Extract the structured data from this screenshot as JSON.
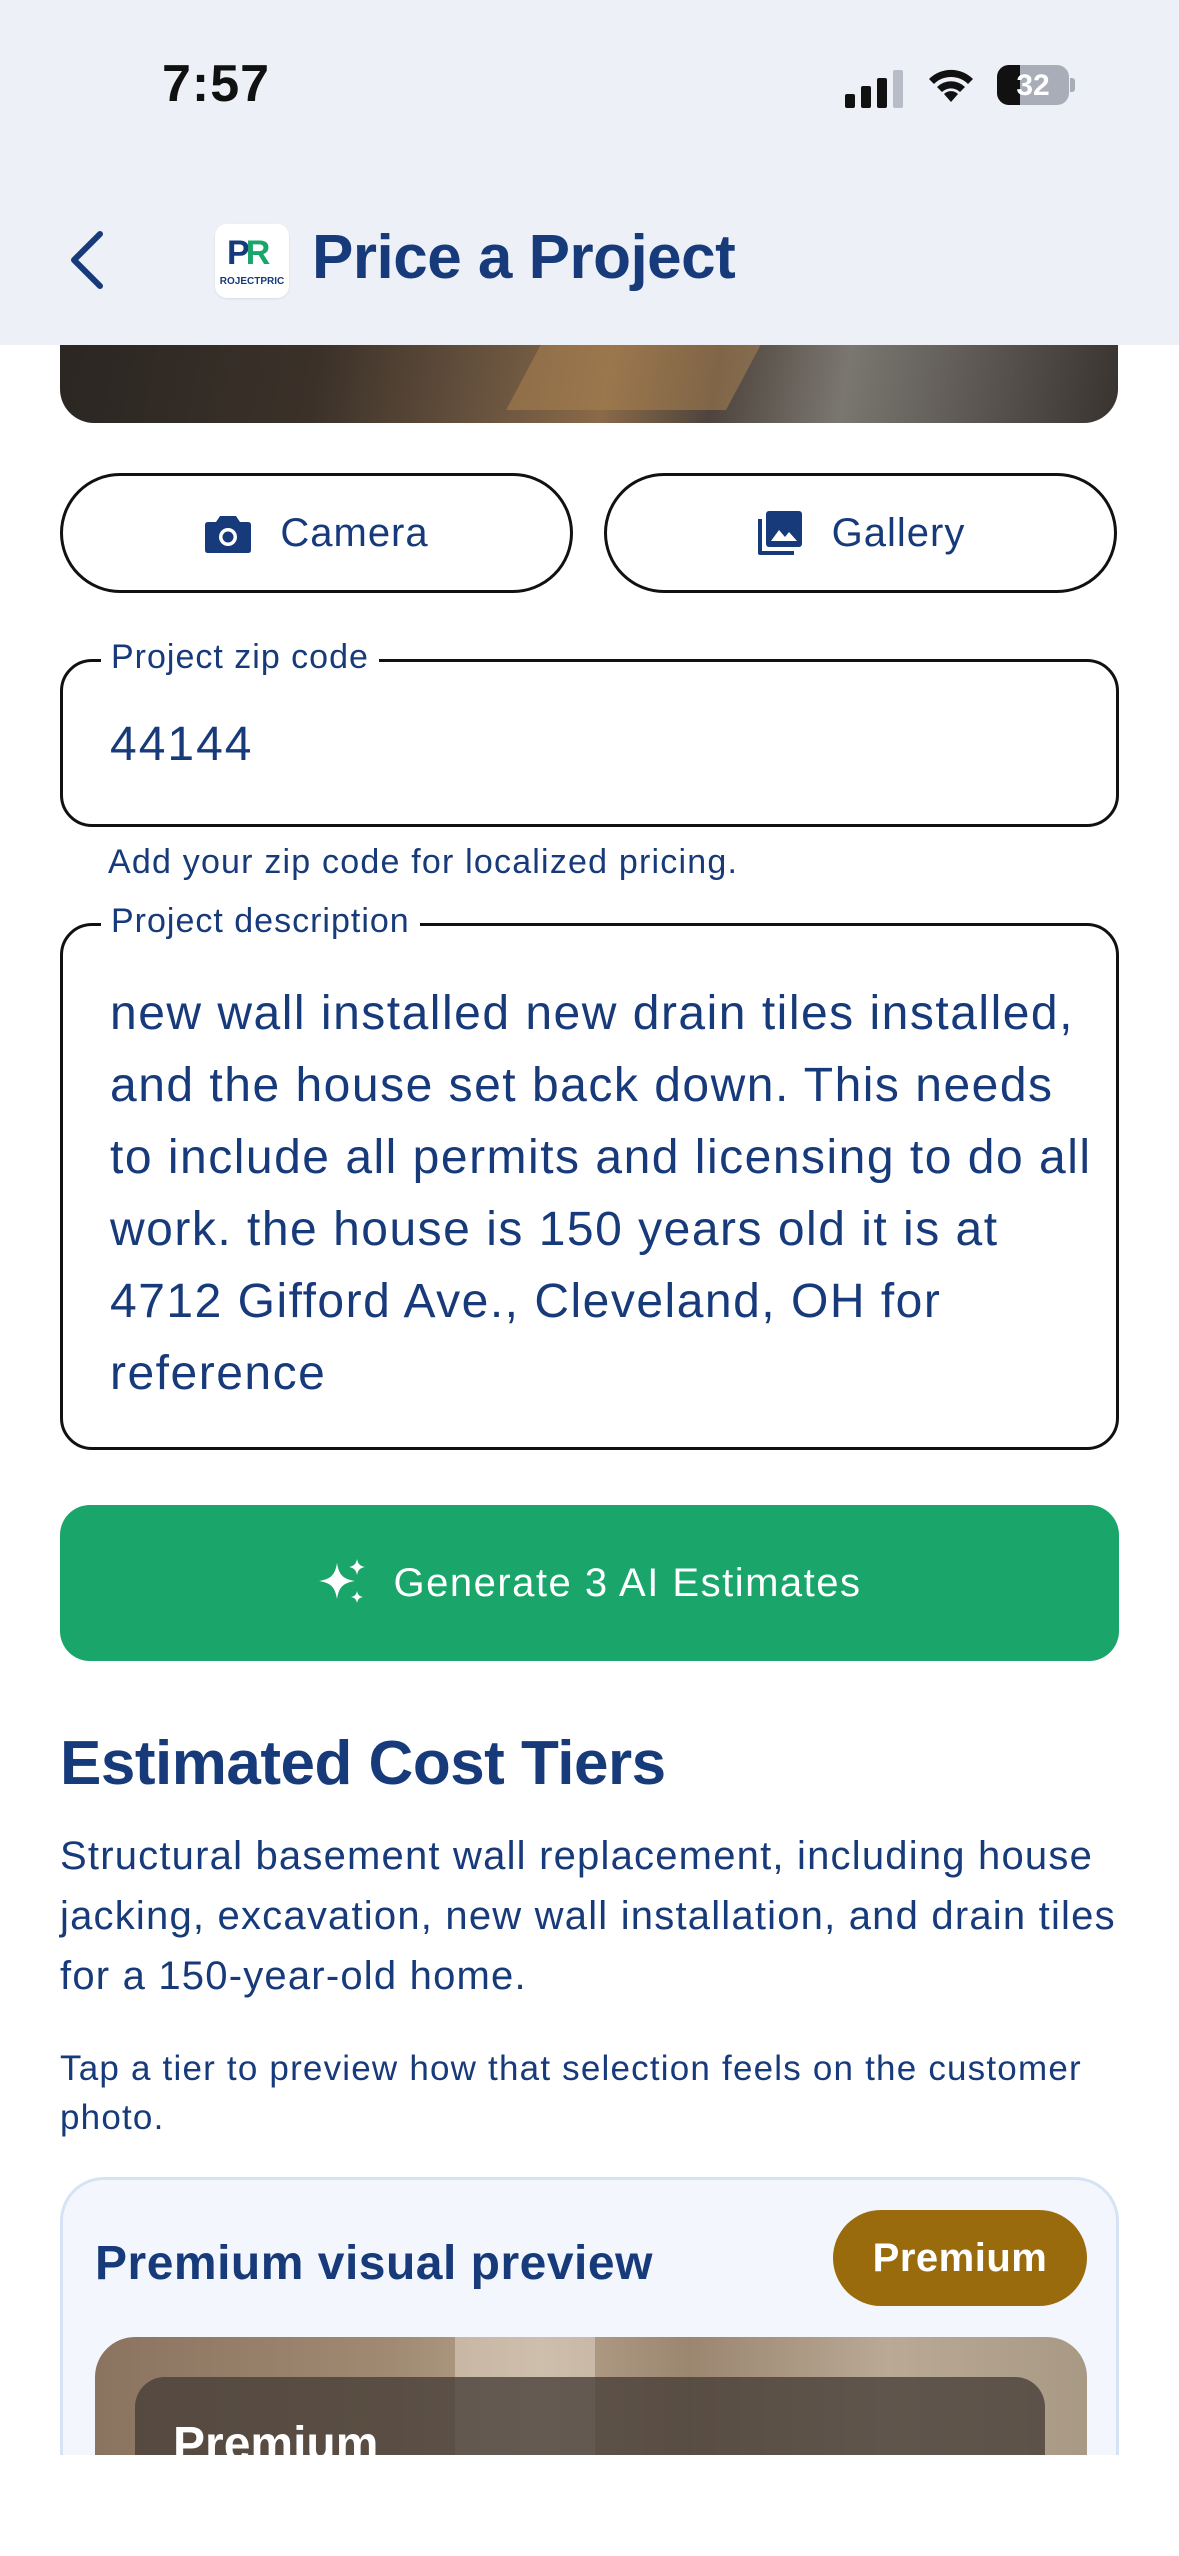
{
  "status_bar": {
    "time": "7:57",
    "battery_percent": "32",
    "battery_level": 0.32
  },
  "header": {
    "title": "Price a Project",
    "logo_text": "PR",
    "logo_caption": "ROJECTPRIC"
  },
  "media_buttons": {
    "camera_label": "Camera",
    "gallery_label": "Gallery"
  },
  "form": {
    "zip_label": "Project zip code",
    "zip_value": "44144",
    "zip_helper": "Add your zip code for localized pricing.",
    "description_label": "Project description",
    "description_value": "new wall installed new drain tiles installed, and the house set back down. This needs to include all permits and licensing to do all work. the house is 150 years old it is at 4712 Gifford Ave., Cleveland, OH for reference"
  },
  "generate_button": {
    "label": "Generate 3 AI Estimates"
  },
  "estimates": {
    "title": "Estimated Cost Tiers",
    "summary": "Structural basement wall replacement, including house jacking, excavation, new wall installation, and drain tiles for a 150-year-old home.",
    "hint": "Tap a tier to preview how that selection feels on the customer photo.",
    "preview_card": {
      "title": "Premium visual preview",
      "badge": "Premium",
      "overlay_label": "Premium"
    }
  },
  "colors": {
    "primary_text": "#173a7a",
    "accent_green": "#1aa56a",
    "premium_badge": "#9a6b0c",
    "header_bg": "#edf0f6"
  }
}
